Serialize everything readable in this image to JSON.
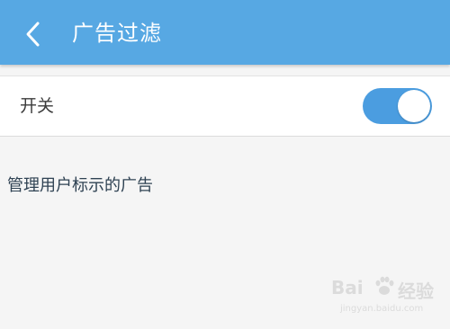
{
  "header": {
    "title": "广告过滤",
    "bg_color": "#57a8e3",
    "back_icon": "chevron-left-icon"
  },
  "settings": {
    "switch_label": "开关",
    "switch_on": true,
    "toggle_color": "#4b9de0"
  },
  "manage": {
    "label": "管理用户标示的广告"
  },
  "watermark": {
    "brand_left": "Bai",
    "brand_right": "经验",
    "url": "jingyan.baidu.com"
  }
}
